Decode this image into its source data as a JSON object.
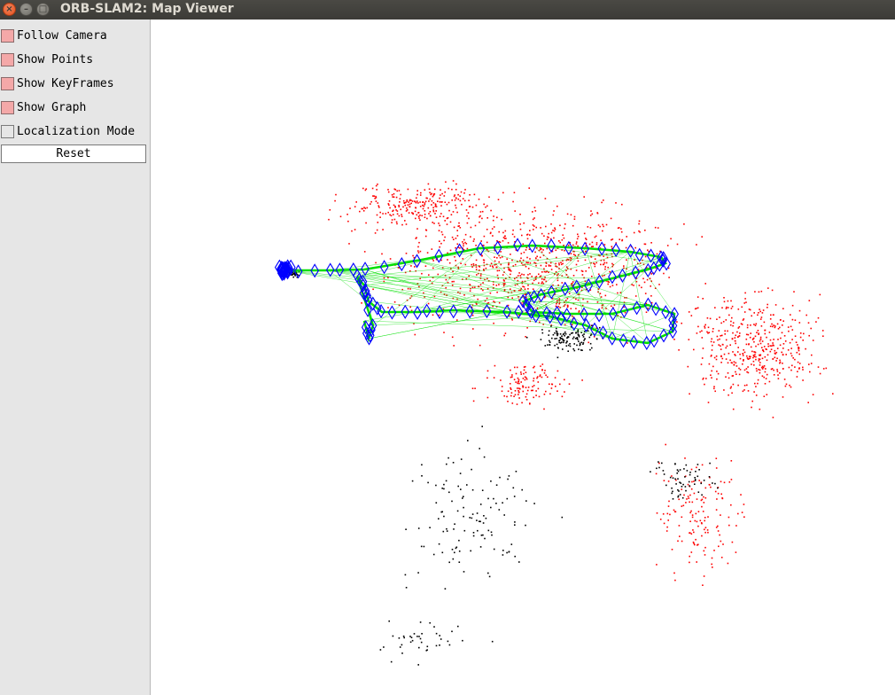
{
  "window": {
    "title": "ORB-SLAM2: Map Viewer",
    "close_glyph": "×",
    "minimize_glyph": "–",
    "maximize_glyph": "□"
  },
  "panel": {
    "items": [
      {
        "label": "Follow Camera",
        "checked": true
      },
      {
        "label": "Show Points",
        "checked": true
      },
      {
        "label": "Show KeyFrames",
        "checked": true
      },
      {
        "label": "Show Graph",
        "checked": true
      },
      {
        "label": "Localization Mode",
        "checked": false
      }
    ],
    "reset_label": "Reset"
  },
  "colors": {
    "checkbox_on": "#f4a8a8",
    "map_points_reference": "#ff0000",
    "map_points_other": "#000000",
    "keyframes": "#0000ff",
    "graph_edges": "#00e000"
  }
}
